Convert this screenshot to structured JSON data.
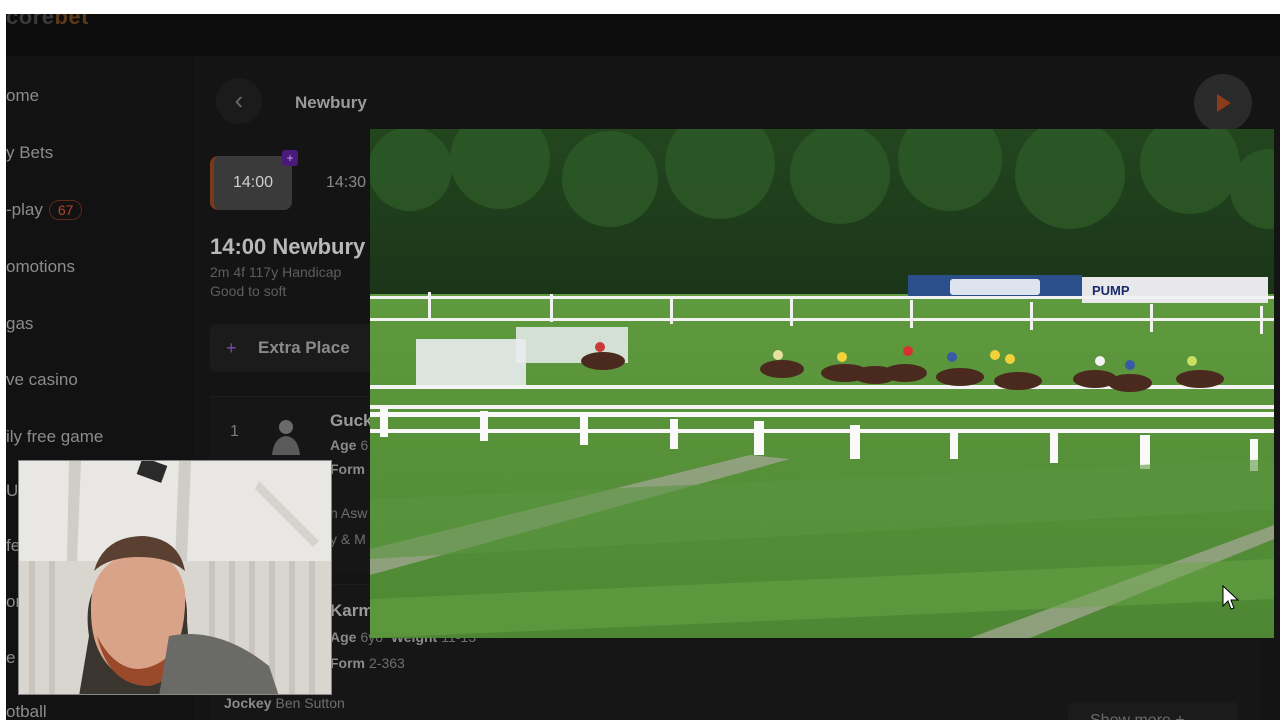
{
  "app": {
    "logo": {
      "part1": "core",
      "part2": "bet"
    }
  },
  "sidebar": {
    "items": [
      {
        "label": "ome"
      },
      {
        "label": "y Bets"
      },
      {
        "label": "-play",
        "badge": "67"
      },
      {
        "label": "omotions"
      },
      {
        "label": "gas"
      },
      {
        "label": "ve casino"
      },
      {
        "label": "ily free game"
      },
      {
        "label": "otball"
      }
    ],
    "partial_labels": [
      "U",
      "fe",
      "or",
      "e"
    ]
  },
  "race_header": {
    "meeting": "Newbury",
    "back_icon": "chevron-left-icon",
    "play_icon": "play-icon"
  },
  "time_tabs": [
    {
      "label": "14:00",
      "active": true,
      "badge": "+"
    },
    {
      "label": "14:30",
      "active": false
    }
  ],
  "race": {
    "title": "14:00 Newbury",
    "details": "2m 4f 117y Handicap",
    "going": "Good to soft"
  },
  "extra_place": {
    "label": "Extra Place"
  },
  "runners": [
    {
      "number": "1",
      "name": "Guck",
      "age_label": "Age",
      "age_value": "6",
      "form_label": "Form",
      "trainer_fragment": "n Asw",
      "jockey_fragment": "y & M"
    },
    {
      "name": "Karm",
      "age_label": "Age",
      "age_value": "6yo",
      "weight_label": "Weight",
      "weight_value": "11-13",
      "form_label": "Form",
      "form_value": "2-363",
      "jockey_label": "Jockey",
      "jockey_value": "Ben Sutton"
    }
  ],
  "show_more": {
    "label": "Show more",
    "icon": "plus-icon"
  },
  "video": {
    "hoardings": [
      "",
      "PUMP"
    ]
  },
  "colors": {
    "accent": "#b0452a",
    "promo": "#7a4ab0",
    "background": "#101010",
    "turf": "#4f8a3a"
  }
}
